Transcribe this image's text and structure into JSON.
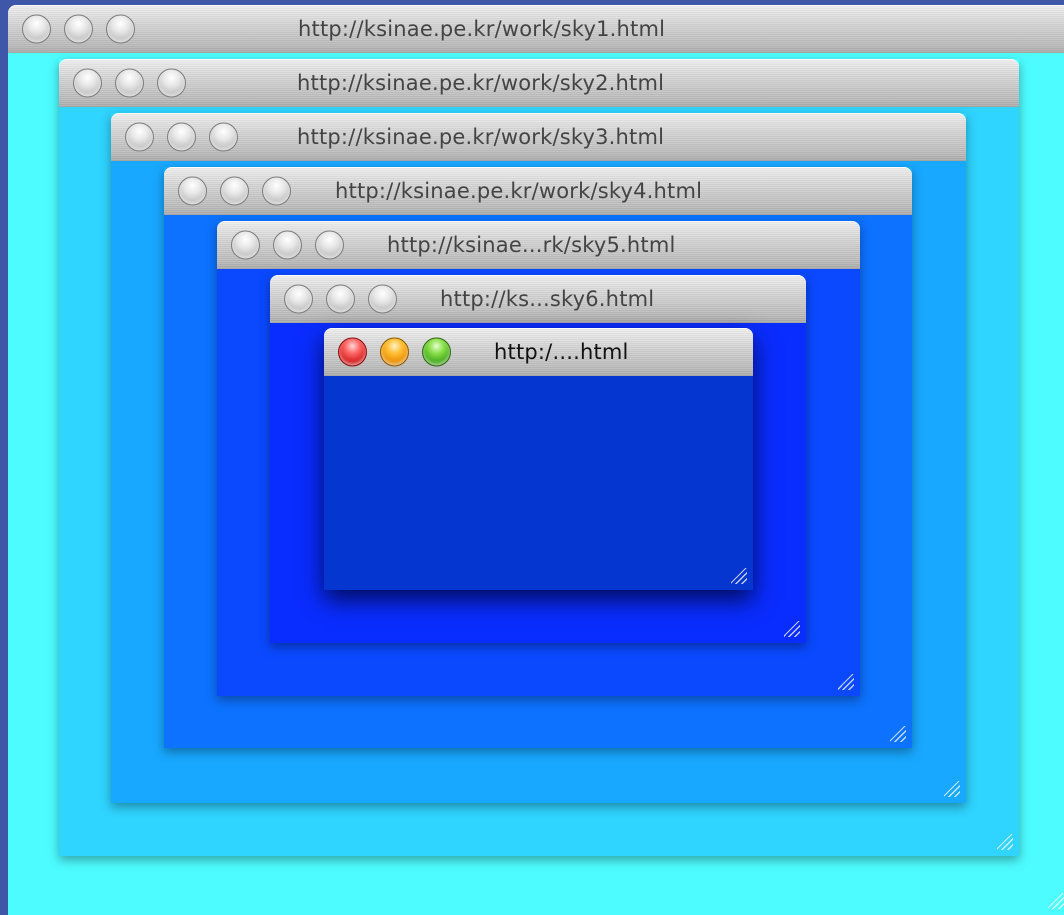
{
  "windows": [
    {
      "title": "http://ksinae.pe.kr/work/sky1.html",
      "color": "#4dfcff",
      "active": false
    },
    {
      "title": "http://ksinae.pe.kr/work/sky2.html",
      "color": "#2fd4ff",
      "active": false
    },
    {
      "title": "http://ksinae.pe.kr/work/sky3.html",
      "color": "#18a8ff",
      "active": false
    },
    {
      "title": "http://ksinae.pe.kr/work/sky4.html",
      "color": "#0d72ff",
      "active": false
    },
    {
      "title": "http://ksinae...rk/sky5.html",
      "color": "#0a49ff",
      "active": false
    },
    {
      "title": "http://ks...sky6.html",
      "color": "#0a2dff",
      "active": false
    },
    {
      "title": "http:/....html",
      "color": "#0636d0",
      "active": true
    }
  ]
}
